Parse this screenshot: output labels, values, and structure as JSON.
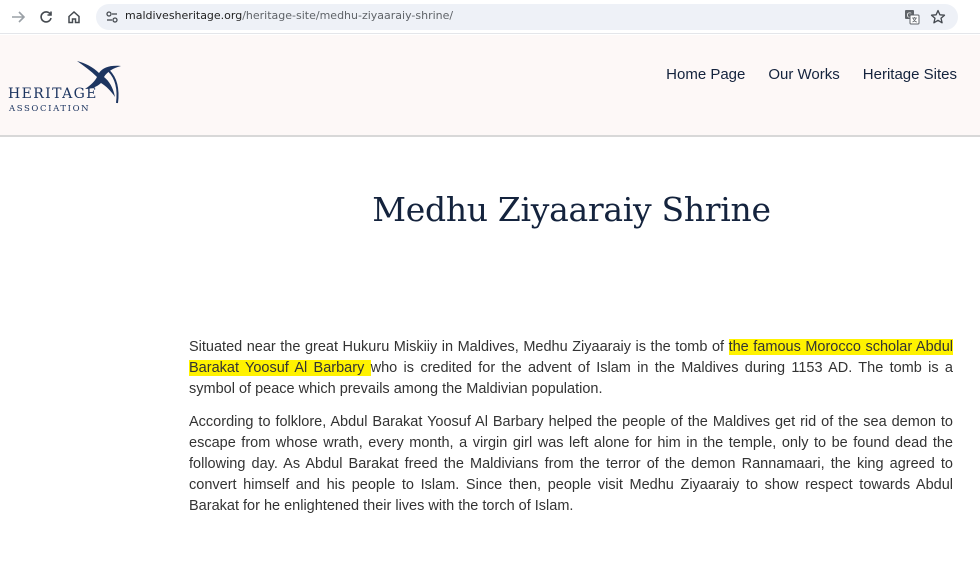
{
  "browser": {
    "url_domain": "maldivesheritage.org",
    "url_path": "/heritage-site/medhu-ziyaaraiy-shrine/",
    "icons": [
      "back-arrow-icon",
      "reload-icon",
      "home-icon",
      "site-info-icon",
      "translate-icon",
      "star-icon"
    ]
  },
  "header": {
    "logo_word": "HERITAGE",
    "logo_sub": "ASSOCIATION",
    "nav": [
      "Home Page",
      "Our Works",
      "Heritage Sites"
    ],
    "colors": {
      "background": "#fdf8f7",
      "brand": "#1d3560"
    }
  },
  "main": {
    "title": "Medhu Ziyaaraiy Shrine",
    "paragraph1": {
      "before": "Situated near the great Hukuru Miskiiy in Maldives, Medhu Ziyaaraiy is the tomb of ",
      "highlight": "the famous Morocco scholar Abdul Barakat Yoosuf Al Barbary ",
      "after": "who is credited for the advent of Islam in the Maldives during 1153 AD. The tomb is a symbol of peace which prevails among the Maldivian population."
    },
    "paragraph2": "According to folklore, Abdul Barakat Yoosuf Al Barbary helped the people of the Maldives get rid of the sea demon to escape from whose wrath, every month, a virgin girl was left alone for him in the temple, only to be found dead the following day. As Abdul Barakat freed the Maldivians from the terror of the demon Rannamaari, the king agreed to convert himself and his people to Islam. Since then, people visit Medhu Ziyaaraiy to show respect towards Abdul Barakat for he enlightened their lives with the torch of Islam.",
    "colors": {
      "highlight": "#fff200",
      "title": "#14233d"
    }
  }
}
